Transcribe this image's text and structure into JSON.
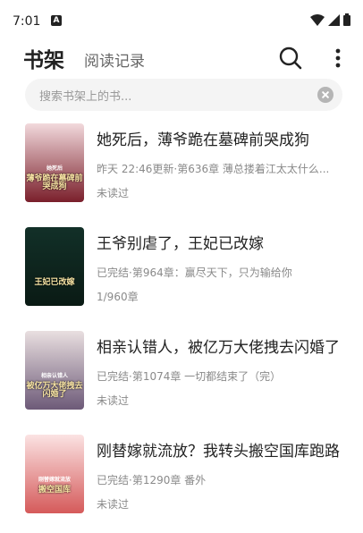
{
  "status_bar": {
    "time": "7:01",
    "notification_letter": "A"
  },
  "header": {
    "title": "书架",
    "history_tab": "阅读记录"
  },
  "search": {
    "placeholder": "搜索书架上的书..."
  },
  "books": [
    {
      "title": "她死后，薄爷跪在墓碑前哭成狗",
      "update": "昨天 22:46更新·第636章 薄总搂着江太太什么...",
      "progress": "未读过",
      "cover_text": "薄爷跪在墓碑前哭成狗",
      "cover_badge": "她死后",
      "cover_colors": [
        "#f2d9dc",
        "#7a1f2b"
      ]
    },
    {
      "title": "王爷别虐了，王妃已改嫁",
      "update": "已完结·第964章：赢尽天下，只为输给你",
      "progress": "1/960章",
      "cover_text": "王妃已改嫁",
      "cover_colors": [
        "#123028",
        "#0a1a14"
      ]
    },
    {
      "title": "相亲认错人，被亿万大佬拽去闪婚了",
      "update": "已完结·第1074章 一切都结束了（完）",
      "progress": "未读过",
      "cover_text": "被亿万大佬拽去闪婚了",
      "cover_badge": "相亲认错人",
      "cover_colors": [
        "#e9dfe0",
        "#6d5a78"
      ]
    },
    {
      "title": "刚替嫁就流放？我转头搬空国库跑路",
      "update": "已完结·第1290章 番外",
      "progress": "未读过",
      "cover_text": "搬空国库",
      "cover_badge": "刚替嫁就流放",
      "cover_colors": [
        "#fbe3e3",
        "#d55a5a"
      ]
    }
  ]
}
